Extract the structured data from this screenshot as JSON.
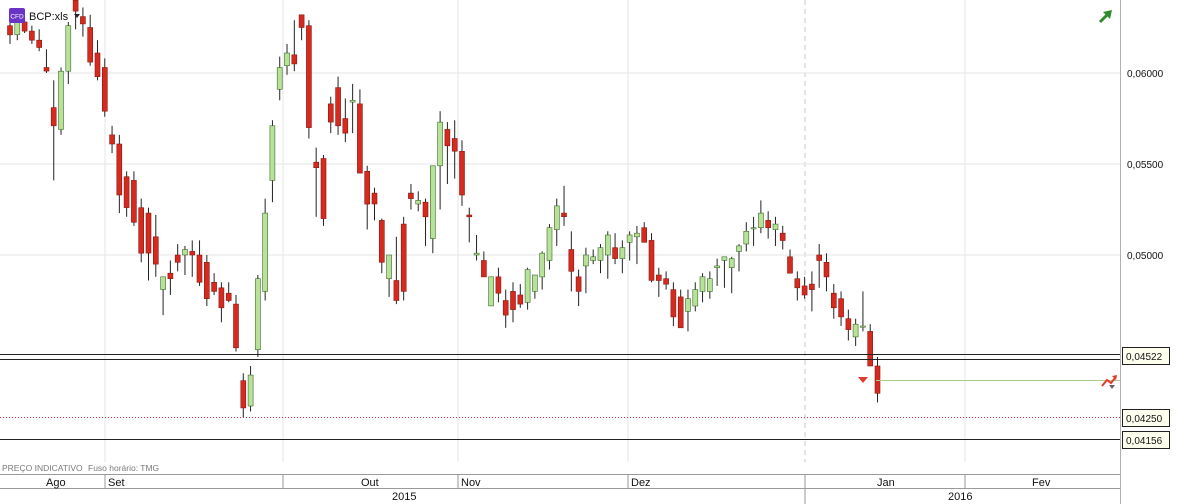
{
  "header": {
    "badge_text": "CFD",
    "symbol": "BCP:xls",
    "dropdown_icon": "caret-down-icon",
    "trend_icon": "trend-up-arrow-icon",
    "tool_icon": "order-tool-icon"
  },
  "footer": {
    "indicative_price": "PREÇO INDICATIVO",
    "timezone": "Fuso horário: TMG"
  },
  "colors": {
    "up_candle": "#b8e29a",
    "down_candle": "#d42a20",
    "last_price_line": "#a8cf8a",
    "dotted_line": "#d33333",
    "grid": "#e6e6e6",
    "badge": "#6a35c7"
  },
  "chart_data": {
    "type": "candlestick",
    "instrument": "BCP:xls",
    "y_axis": {
      "ticks": [
        "0,06000",
        "0,05500",
        "0,05000"
      ],
      "tick_values": [
        0.06,
        0.055,
        0.05
      ],
      "range": [
        0.0385,
        0.0635
      ]
    },
    "x_axis": {
      "months": [
        "Ago",
        "Set",
        "Out",
        "Nov",
        "Dez",
        "Jan",
        "Fev"
      ],
      "years": [
        "2015",
        "2016"
      ]
    },
    "horizontal_lines": [
      {
        "label": "0,04522",
        "value": 0.04522,
        "style": "solid"
      },
      {
        "label": "0,04250",
        "value": 0.0425,
        "style": "dotted"
      },
      {
        "label": "0,04156",
        "value": 0.04156,
        "style": "solid"
      }
    ],
    "last_close": 0.0439,
    "candles": [
      [
        0.0626,
        0.063,
        0.0616,
        0.0621
      ],
      [
        0.0621,
        0.063,
        0.0618,
        0.0628
      ],
      [
        0.0628,
        0.0631,
        0.0622,
        0.0623
      ],
      [
        0.0623,
        0.0626,
        0.0616,
        0.0618
      ],
      [
        0.0618,
        0.0624,
        0.0612,
        0.0614
      ],
      [
        0.0603,
        0.0613,
        0.06,
        0.0601
      ],
      [
        0.0581,
        0.0596,
        0.0541,
        0.0571
      ],
      [
        0.0569,
        0.0603,
        0.0566,
        0.0601
      ],
      [
        0.0601,
        0.0628,
        0.0594,
        0.0626
      ],
      [
        0.064,
        0.0648,
        0.0624,
        0.0634
      ],
      [
        0.0631,
        0.0636,
        0.062,
        0.0627
      ],
      [
        0.0625,
        0.0632,
        0.0604,
        0.0606
      ],
      [
        0.0611,
        0.0618,
        0.0596,
        0.0598
      ],
      [
        0.0603,
        0.0608,
        0.0576,
        0.0579
      ],
      [
        0.0566,
        0.0571,
        0.0556,
        0.0561
      ],
      [
        0.0561,
        0.0566,
        0.0523,
        0.0533
      ],
      [
        0.0543,
        0.0546,
        0.0521,
        0.0526
      ],
      [
        0.0541,
        0.0546,
        0.0516,
        0.0518
      ],
      [
        0.0526,
        0.0531,
        0.0496,
        0.0501
      ],
      [
        0.0523,
        0.0526,
        0.0486,
        0.0501
      ],
      [
        0.051,
        0.0522,
        0.0488,
        0.0495
      ],
      [
        0.0481,
        0.0488,
        0.0467,
        0.0488
      ],
      [
        0.049,
        0.0497,
        0.0478,
        0.0487
      ],
      [
        0.05,
        0.0506,
        0.0491,
        0.0496
      ],
      [
        0.05,
        0.0505,
        0.0489,
        0.0503
      ],
      [
        0.0502,
        0.0508,
        0.0488,
        0.05
      ],
      [
        0.05,
        0.0508,
        0.0483,
        0.0485
      ],
      [
        0.0496,
        0.05,
        0.0472,
        0.0476
      ],
      [
        0.0485,
        0.049,
        0.0478,
        0.048
      ],
      [
        0.0482,
        0.0485,
        0.0463,
        0.0471
      ],
      [
        0.0479,
        0.0485,
        0.0474,
        0.0475
      ],
      [
        0.0473,
        0.0478,
        0.0447,
        0.0449
      ],
      [
        0.0431,
        0.0435,
        0.0411,
        0.0416
      ],
      [
        0.0417,
        0.0439,
        0.0414,
        0.0434
      ],
      [
        0.0448,
        0.0489,
        0.0444,
        0.0487
      ],
      [
        0.048,
        0.0531,
        0.0475,
        0.0523
      ],
      [
        0.0541,
        0.0574,
        0.0529,
        0.0571
      ],
      [
        0.0591,
        0.0609,
        0.0585,
        0.0603
      ],
      [
        0.0604,
        0.0616,
        0.0599,
        0.0611
      ],
      [
        0.061,
        0.0629,
        0.0601,
        0.0605
      ],
      [
        0.0632,
        0.0632,
        0.0618,
        0.0625
      ],
      [
        0.0626,
        0.0629,
        0.0564,
        0.057
      ],
      [
        0.0551,
        0.0559,
        0.0521,
        0.0548
      ],
      [
        0.0553,
        0.0555,
        0.0516,
        0.052
      ],
      [
        0.0583,
        0.0587,
        0.0567,
        0.0573
      ],
      [
        0.0592,
        0.0598,
        0.0566,
        0.0571
      ],
      [
        0.0575,
        0.0586,
        0.0562,
        0.0567
      ],
      [
        0.0584,
        0.0594,
        0.0567,
        0.0585
      ],
      [
        0.0583,
        0.0591,
        0.0567,
        0.0545
      ],
      [
        0.0546,
        0.0549,
        0.0514,
        0.0528
      ],
      [
        0.0534,
        0.0537,
        0.0519,
        0.0528
      ],
      [
        0.0519,
        0.052,
        0.049,
        0.0496
      ],
      [
        0.0487,
        0.05,
        0.0477,
        0.05
      ],
      [
        0.0486,
        0.051,
        0.0473,
        0.0475
      ],
      [
        0.0517,
        0.0521,
        0.0475,
        0.048
      ],
      [
        0.0534,
        0.0539,
        0.0525,
        0.0531
      ],
      [
        0.0528,
        0.0535,
        0.0524,
        0.053
      ],
      [
        0.0529,
        0.0531,
        0.0505,
        0.0521
      ],
      [
        0.0509,
        0.0532,
        0.0501,
        0.0549
      ],
      [
        0.0549,
        0.0579,
        0.0525,
        0.0573
      ],
      [
        0.0569,
        0.0573,
        0.0539,
        0.056
      ],
      [
        0.0564,
        0.0574,
        0.0542,
        0.0557
      ],
      [
        0.0557,
        0.0563,
        0.0527,
        0.0533
      ],
      [
        0.0522,
        0.0526,
        0.0507,
        0.0521
      ],
      [
        0.05,
        0.0511,
        0.0497,
        0.0501
      ],
      [
        0.0497,
        0.0502,
        0.049,
        0.0488
      ],
      [
        0.0472,
        0.048,
        0.0481,
        0.0488
      ],
      [
        0.0488,
        0.0493,
        0.0474,
        0.0479
      ],
      [
        0.0475,
        0.0481,
        0.046,
        0.0467
      ],
      [
        0.048,
        0.0485,
        0.0463,
        0.047
      ],
      [
        0.0478,
        0.0484,
        0.0471,
        0.0473
      ],
      [
        0.0474,
        0.0493,
        0.047,
        0.0492
      ],
      [
        0.048,
        0.0489,
        0.0476,
        0.0489
      ],
      [
        0.0488,
        0.0502,
        0.0481,
        0.0501
      ],
      [
        0.0497,
        0.0517,
        0.0492,
        0.0515
      ],
      [
        0.0514,
        0.0531,
        0.0505,
        0.0527
      ],
      [
        0.0523,
        0.0538,
        0.0516,
        0.0521
      ],
      [
        0.0503,
        0.0513,
        0.048,
        0.0491
      ],
      [
        0.0488,
        0.0492,
        0.0472,
        0.048
      ],
      [
        0.0494,
        0.0504,
        0.0479,
        0.05
      ],
      [
        0.0497,
        0.0503,
        0.0495,
        0.0499
      ],
      [
        0.0497,
        0.0506,
        0.049,
        0.0504
      ],
      [
        0.05,
        0.0513,
        0.0487,
        0.0511
      ],
      [
        0.0504,
        0.0512,
        0.0495,
        0.0498
      ],
      [
        0.0498,
        0.0508,
        0.049,
        0.0504
      ],
      [
        0.0507,
        0.0513,
        0.0497,
        0.0511
      ],
      [
        0.051,
        0.0516,
        0.0495,
        0.0512
      ],
      [
        0.0515,
        0.0518,
        0.0507,
        0.0507
      ],
      [
        0.0508,
        0.0512,
        0.0485,
        0.0486
      ],
      [
        0.0489,
        0.0493,
        0.0477,
        0.0486
      ],
      [
        0.0487,
        0.0491,
        0.0481,
        0.0484
      ],
      [
        0.0481,
        0.0485,
        0.0461,
        0.0466
      ],
      [
        0.0477,
        0.0481,
        0.0462,
        0.046
      ],
      [
        0.0469,
        0.0481,
        0.0458,
        0.0476
      ],
      [
        0.0472,
        0.0485,
        0.0469,
        0.0481
      ],
      [
        0.048,
        0.049,
        0.0474,
        0.0488
      ],
      [
        0.048,
        0.0491,
        0.0476,
        0.0487
      ],
      [
        0.0493,
        0.0498,
        0.0483,
        0.0494
      ],
      [
        0.0497,
        0.0499,
        0.0482,
        0.0499
      ],
      [
        0.0493,
        0.0499,
        0.0479,
        0.0498
      ],
      [
        0.0502,
        0.0506,
        0.0491,
        0.0505
      ],
      [
        0.0506,
        0.0518,
        0.0502,
        0.0513
      ],
      [
        0.0515,
        0.0521,
        0.0505,
        0.0515
      ],
      [
        0.0515,
        0.053,
        0.0512,
        0.0523
      ],
      [
        0.0519,
        0.0524,
        0.0509,
        0.0515
      ],
      [
        0.0514,
        0.0521,
        0.0505,
        0.0517
      ],
      [
        0.0512,
        0.0516,
        0.0503,
        0.0508
      ],
      [
        0.0499,
        0.0503,
        0.0491,
        0.049
      ],
      [
        0.0487,
        0.0491,
        0.0475,
        0.0482
      ],
      [
        0.0483,
        0.0488,
        0.0476,
        0.0478
      ],
      [
        0.0484,
        0.0491,
        0.0469,
        0.0481
      ],
      [
        0.05,
        0.0506,
        0.0482,
        0.0497
      ],
      [
        0.0496,
        0.0501,
        0.048,
        0.0488
      ],
      [
        0.0479,
        0.0484,
        0.0465,
        0.0471
      ],
      [
        0.0476,
        0.048,
        0.0461,
        0.0466
      ],
      [
        0.0465,
        0.047,
        0.0453,
        0.0459
      ],
      [
        0.0455,
        0.0465,
        0.045,
        0.0462
      ],
      [
        0.0461,
        0.048,
        0.0458,
        0.0461
      ],
      [
        0.0458,
        0.0462,
        0.0441,
        0.0439
      ],
      [
        0.0439,
        0.0444,
        0.0419,
        0.0424
      ]
    ]
  }
}
